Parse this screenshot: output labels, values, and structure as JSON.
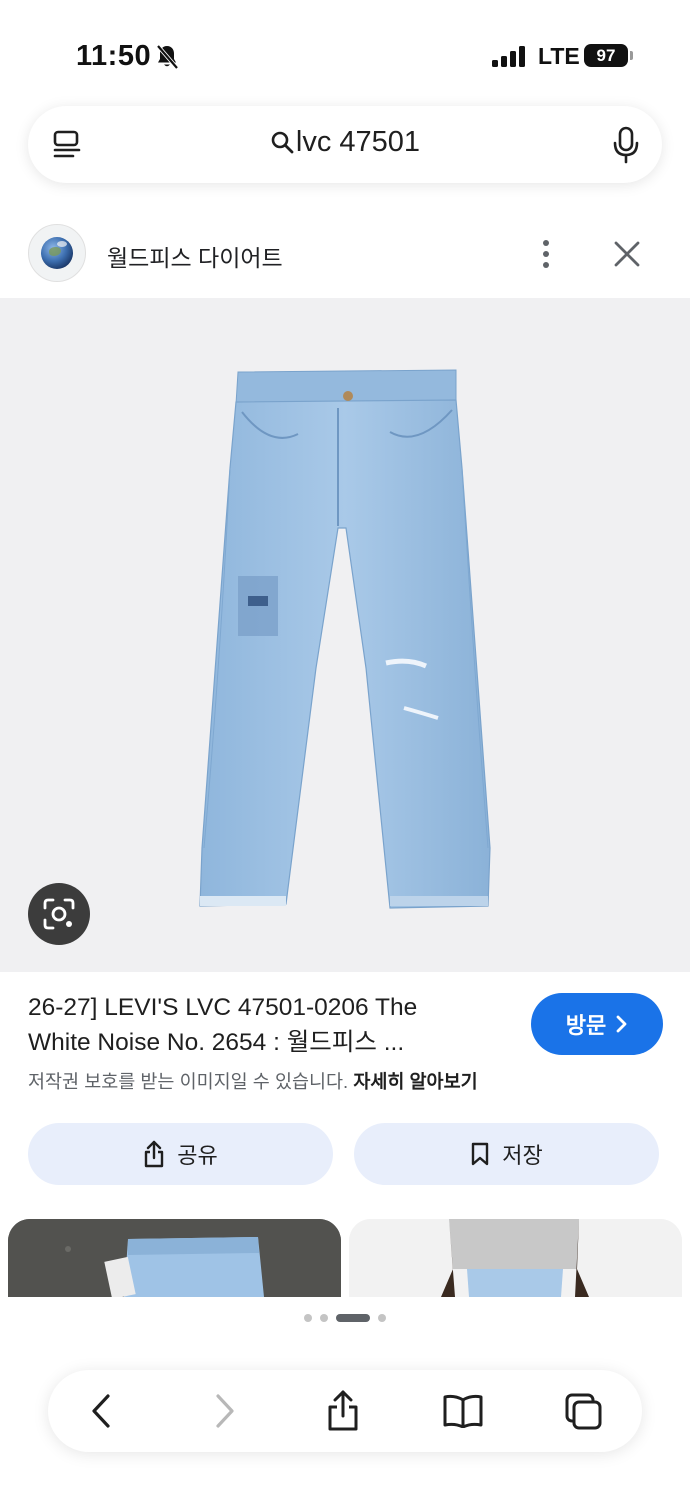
{
  "status_bar": {
    "time": "11:50",
    "network": "LTE",
    "battery": "97"
  },
  "search": {
    "query": "lvc 47501"
  },
  "source": {
    "name": "월드피스 다이어트"
  },
  "result": {
    "title_line1": "26-27] LEVI'S LVC 47501-0206 The",
    "title_line2": "White Noise No. 2654 : 월드피스 ...",
    "visit_label": "방문",
    "copyright_text": "저작권 보호를 받는 이미지일 수 있습니다.",
    "learn_more": "자세히 알아보기",
    "share_label": "공유",
    "save_label": "저장"
  },
  "pagination": {
    "count": 5,
    "active_index": 2
  },
  "colors": {
    "accent": "#1a73e8",
    "chip_bg": "#e8eefb",
    "image_bg": "#f0f0f2"
  },
  "icons": [
    "bell-slash-icon",
    "signal-icon",
    "battery-icon",
    "menu-icon",
    "search-icon",
    "mic-icon",
    "more-vert-icon",
    "close-icon",
    "lens-icon",
    "share-icon",
    "bookmark-icon",
    "back-icon",
    "forward-icon",
    "tabs-icon",
    "bookmarks-book-icon"
  ]
}
